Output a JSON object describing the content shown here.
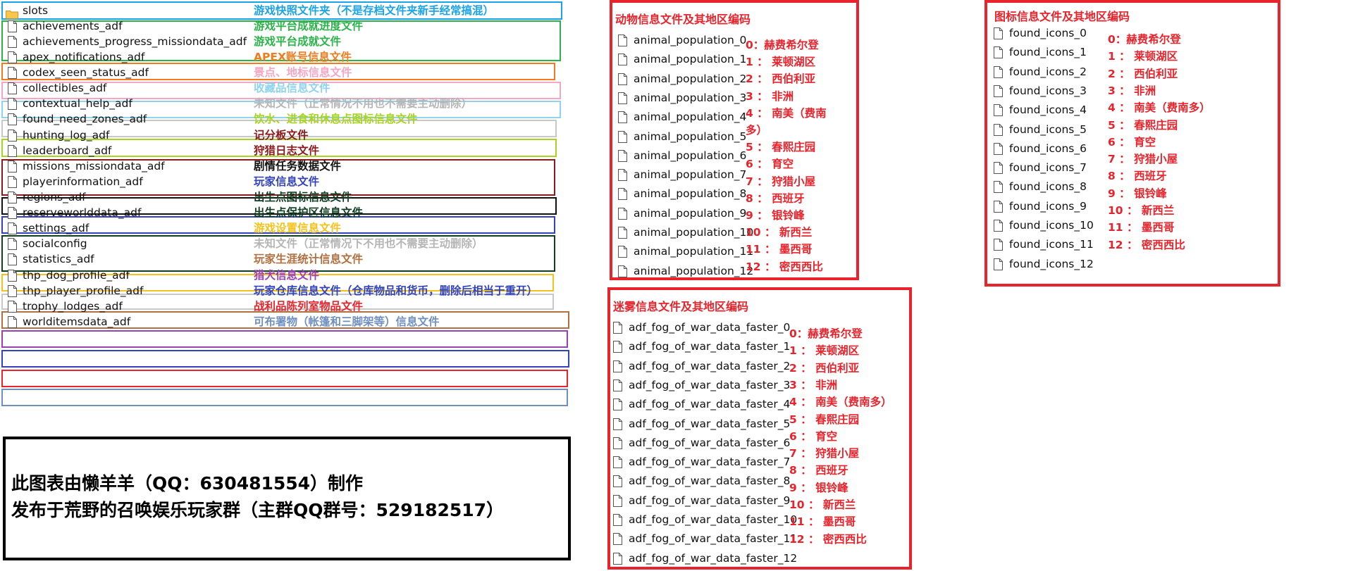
{
  "file_list": [
    {
      "name": "slots",
      "desc": "游戏快照文件夹（不是存档文件夹新手经常搞混）",
      "icon": "folder-icon",
      "border": "#1aa3e8",
      "color": "#1aa3e8"
    },
    {
      "name": "achievements_adf",
      "desc": "游戏平台成就进度文件",
      "icon": "file-icon",
      "border": "#2bb34a",
      "color": "#2bb34a"
    },
    {
      "name": "achievements_progress_missiondata_adf",
      "desc": "游戏平台成就文件",
      "icon": "file-icon",
      "border": "#2bb34a",
      "color": "#2bb34a"
    },
    {
      "name": "apex_notifications_adf",
      "desc": "APEX账号信息文件",
      "icon": "file-icon",
      "border": "#f07c1e",
      "color": "#f07c1e"
    },
    {
      "name": "codex_seen_status_adf",
      "desc": "景点、地标信息文件",
      "icon": "file-icon",
      "border": "#f4a6c2",
      "color": "#f4a6c2"
    },
    {
      "name": "collectibles_adf",
      "desc": "收藏品信息文件",
      "icon": "file-icon",
      "border": "#8fd3ee",
      "color": "#8fd3ee"
    },
    {
      "name": "contextual_help_adf",
      "desc": "未知文件（正常情况不用也不需要主动删除）",
      "icon": "file-icon",
      "border": "#c8c8c8",
      "color": "#b5b5b5"
    },
    {
      "name": "found_need_zones_adf",
      "desc": "饮水、进食和休息点图标信息文件",
      "icon": "file-icon",
      "border": "#a8d420",
      "color": "#a8d420"
    },
    {
      "name": "hunting_log_adf",
      "desc": "记分板文件",
      "icon": "file-icon",
      "border": "#8b1a1a",
      "color": "#8b1a1a"
    },
    {
      "name": "leaderboard_adf",
      "desc": "狩猎日志文件",
      "icon": "file-icon",
      "border": "#8b1a1a",
      "color": "#8b1a1a"
    },
    {
      "name": "missions_missiondata_adf",
      "desc": "剧情任务数据文件",
      "icon": "file-icon",
      "border": "#111111",
      "color": "#111111"
    },
    {
      "name": "playerinformation_adf",
      "desc": "玩家信息文件",
      "icon": "file-icon",
      "border": "#3344bb",
      "color": "#3344bb"
    },
    {
      "name": "regions_adf",
      "desc": "出生点图标信息文件",
      "icon": "file-icon",
      "border": "#0f3d1f",
      "color": "#0f3d1f"
    },
    {
      "name": "reserveworlddata_adf",
      "desc": "出生点保护区信息文件",
      "icon": "file-icon",
      "border": "#0f3d1f",
      "color": "#0f3d1f"
    },
    {
      "name": "settings_adf",
      "desc": "游戏设置信息文件",
      "icon": "file-icon",
      "border": "#f4c21a",
      "color": "#f4c21a"
    },
    {
      "name": "socialconfig",
      "desc": "未知文件（正常情况下不用也不需要主动删除）",
      "icon": "file-icon",
      "border": "#c8c8c8",
      "color": "#b5b5b5"
    },
    {
      "name": "statistics_adf",
      "desc": "玩家生涯统计信息文件",
      "icon": "file-icon",
      "border": "#b07040",
      "color": "#b07040"
    },
    {
      "name": "thp_dog_profile_adf",
      "desc": "猎犬信息文件",
      "icon": "file-icon",
      "border": "#9a40b0",
      "color": "#9a40b0"
    },
    {
      "name": "thp_player_profile_adf",
      "desc": "玩家仓库信息文件（仓库物品和货币，删除后相当于重开）",
      "icon": "file-icon",
      "border": "#3344bb",
      "color": "#3344bb"
    },
    {
      "name": "trophy_lodges_adf",
      "desc": "战利品陈列室物品文件",
      "icon": "file-icon",
      "border": "#e8232b",
      "color": "#e8232b"
    },
    {
      "name": "worlditemsdata_adf",
      "desc": "可布署物（帐篷和三脚架等）信息文件",
      "icon": "file-icon",
      "border": "#6f8fc0",
      "color": "#6f8fc0"
    }
  ],
  "animal_panel": {
    "title": "动物信息文件及其地区编码",
    "files": [
      "animal_population_0",
      "animal_population_1",
      "animal_population_2",
      "animal_population_3",
      "animal_population_4",
      "animal_population_5",
      "animal_population_6",
      "animal_population_7",
      "animal_population_8",
      "animal_population_9",
      "animal_population_10",
      "animal_population_11",
      "animal_population_12"
    ],
    "codes": [
      "0：赫费希尔登",
      "1 ： 莱顿湖区",
      "2 ： 西伯利亚",
      "3 ： 非洲",
      "4 ： 南美（费南",
      "多）",
      "5 ： 春熙庄园",
      "6 ： 育空",
      "7 ： 狩猎小屋",
      "8 ： 西班牙",
      "9 ： 银铃峰",
      "10 ： 新西兰",
      "11 ： 墨西哥",
      "12 ： 密西西比"
    ]
  },
  "fog_panel": {
    "title": "迷雾信息文件及其地区编码",
    "files": [
      "adf_fog_of_war_data_faster_0",
      "adf_fog_of_war_data_faster_1",
      "adf_fog_of_war_data_faster_2",
      "adf_fog_of_war_data_faster_3",
      "adf_fog_of_war_data_faster_4",
      "adf_fog_of_war_data_faster_5",
      "adf_fog_of_war_data_faster_6",
      "adf_fog_of_war_data_faster_7",
      "adf_fog_of_war_data_faster_8",
      "adf_fog_of_war_data_faster_9",
      "adf_fog_of_war_data_faster_10",
      "adf_fog_of_war_data_faster_11",
      "adf_fog_of_war_data_faster_12"
    ],
    "codes": [
      "0：赫费希尔登",
      "1 ： 莱顿湖区",
      "2 ： 西伯利亚",
      "3 ： 非洲",
      "4 ： 南美（费南多）",
      "5 ： 春熙庄园",
      "6 ： 育空",
      "7 ： 狩猎小屋",
      "8 ： 西班牙",
      "9 ： 银铃峰",
      "10 ： 新西兰",
      "11 ： 墨西哥",
      "12 ： 密西西比"
    ]
  },
  "icons_panel": {
    "title": "图标信息文件及其地区编码",
    "files": [
      "found_icons_0",
      "found_icons_1",
      "found_icons_2",
      "found_icons_3",
      "found_icons_4",
      "found_icons_5",
      "found_icons_6",
      "found_icons_7",
      "found_icons_8",
      "found_icons_9",
      "found_icons_10",
      "found_icons_11",
      "found_icons_12"
    ],
    "codes": [
      "0：赫费希尔登",
      "1 ： 莱顿湖区",
      "2 ： 西伯利亚",
      "3 ： 非洲",
      "4 ： 南美（费南多）",
      "5 ： 春熙庄园",
      "6 ： 育空",
      "7 ： 狩猎小屋",
      "8 ： 西班牙",
      "9 ： 银铃峰",
      "10 ： 新西兰",
      "11 ： 墨西哥",
      "12 ： 密西西比"
    ]
  },
  "credit": {
    "line1": "此图表由懒羊羊（QQ：630481554）制作",
    "line2": "发布于荒野的召唤娱乐玩家群（主群QQ群号：529182517）"
  }
}
